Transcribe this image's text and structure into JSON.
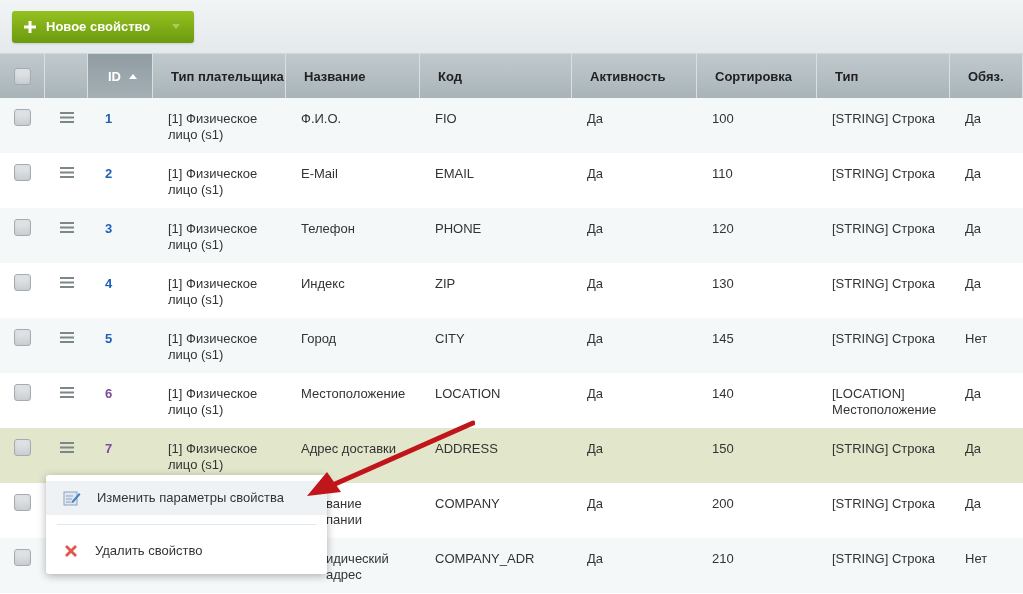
{
  "toolbar": {
    "add_button": "Новое свойство"
  },
  "table": {
    "header_checkbox": {
      "checked": false
    },
    "columns": [
      {
        "label": "ID",
        "sorted": true
      },
      {
        "label": "Тип плательщика",
        "sorted": false
      },
      {
        "label": "Название",
        "sorted": false
      },
      {
        "label": "Код",
        "sorted": false
      },
      {
        "label": "Активность",
        "sorted": false
      },
      {
        "label": "Сортировка",
        "sorted": false
      },
      {
        "label": "Тип",
        "sorted": false
      },
      {
        "label": "Обяз.",
        "sorted": false
      }
    ],
    "rows": [
      {
        "id": "1",
        "visited": false,
        "selected": false,
        "partial": false,
        "checked": false,
        "payer": "[1] Физическое лицо (s1)",
        "name": "Ф.И.О.",
        "code": "FIO",
        "active": "Да",
        "sort": "100",
        "type": "[STRING] Строка",
        "required": "Да"
      },
      {
        "id": "2",
        "visited": false,
        "selected": false,
        "partial": false,
        "checked": false,
        "payer": "[1] Физическое лицо (s1)",
        "name": "E-Mail",
        "code": "EMAIL",
        "active": "Да",
        "sort": "110",
        "type": "[STRING] Строка",
        "required": "Да"
      },
      {
        "id": "3",
        "visited": false,
        "selected": false,
        "partial": false,
        "checked": false,
        "payer": "[1] Физическое лицо (s1)",
        "name": "Телефон",
        "code": "PHONE",
        "active": "Да",
        "sort": "120",
        "type": "[STRING] Строка",
        "required": "Да"
      },
      {
        "id": "4",
        "visited": false,
        "selected": false,
        "partial": false,
        "checked": false,
        "payer": "[1] Физическое лицо (s1)",
        "name": "Индекс",
        "code": "ZIP",
        "active": "Да",
        "sort": "130",
        "type": "[STRING] Строка",
        "required": "Да"
      },
      {
        "id": "5",
        "visited": false,
        "selected": false,
        "partial": false,
        "checked": false,
        "payer": "[1] Физическое лицо (s1)",
        "name": "Город",
        "code": "CITY",
        "active": "Да",
        "sort": "145",
        "type": "[STRING] Строка",
        "required": "Нет"
      },
      {
        "id": "6",
        "visited": true,
        "selected": false,
        "partial": false,
        "checked": false,
        "payer": "[1] Физическое лицо (s1)",
        "name": "Местоположение",
        "code": "LOCATION",
        "active": "Да",
        "sort": "140",
        "type": "[LOCATION] Местоположение",
        "required": "Да"
      },
      {
        "id": "7",
        "visited": true,
        "selected": true,
        "partial": false,
        "checked": false,
        "payer": "[1] Физическое лицо (s1)",
        "name": "Адрес доставки",
        "code": "ADDRESS",
        "active": "Да",
        "sort": "150",
        "type": "[STRING] Строка",
        "required": "Да"
      },
      {
        "selected": false,
        "partial": true,
        "checked": false,
        "name": "вание пании",
        "code": "COMPANY",
        "active": "Да",
        "sort": "200",
        "type": "[STRING] Строка",
        "required": "Да"
      },
      {
        "selected": false,
        "partial": true,
        "checked": false,
        "name": "идический адрес",
        "code": "COMPANY_ADR",
        "active": "Да",
        "sort": "210",
        "type": "[STRING] Строка",
        "required": "Нет"
      }
    ]
  },
  "context_menu": {
    "items": [
      {
        "kind": "edit",
        "label": "Изменить параметры свойства",
        "selected": true
      },
      {
        "kind": "delete",
        "label": "Удалить свойство",
        "selected": false
      }
    ]
  }
}
